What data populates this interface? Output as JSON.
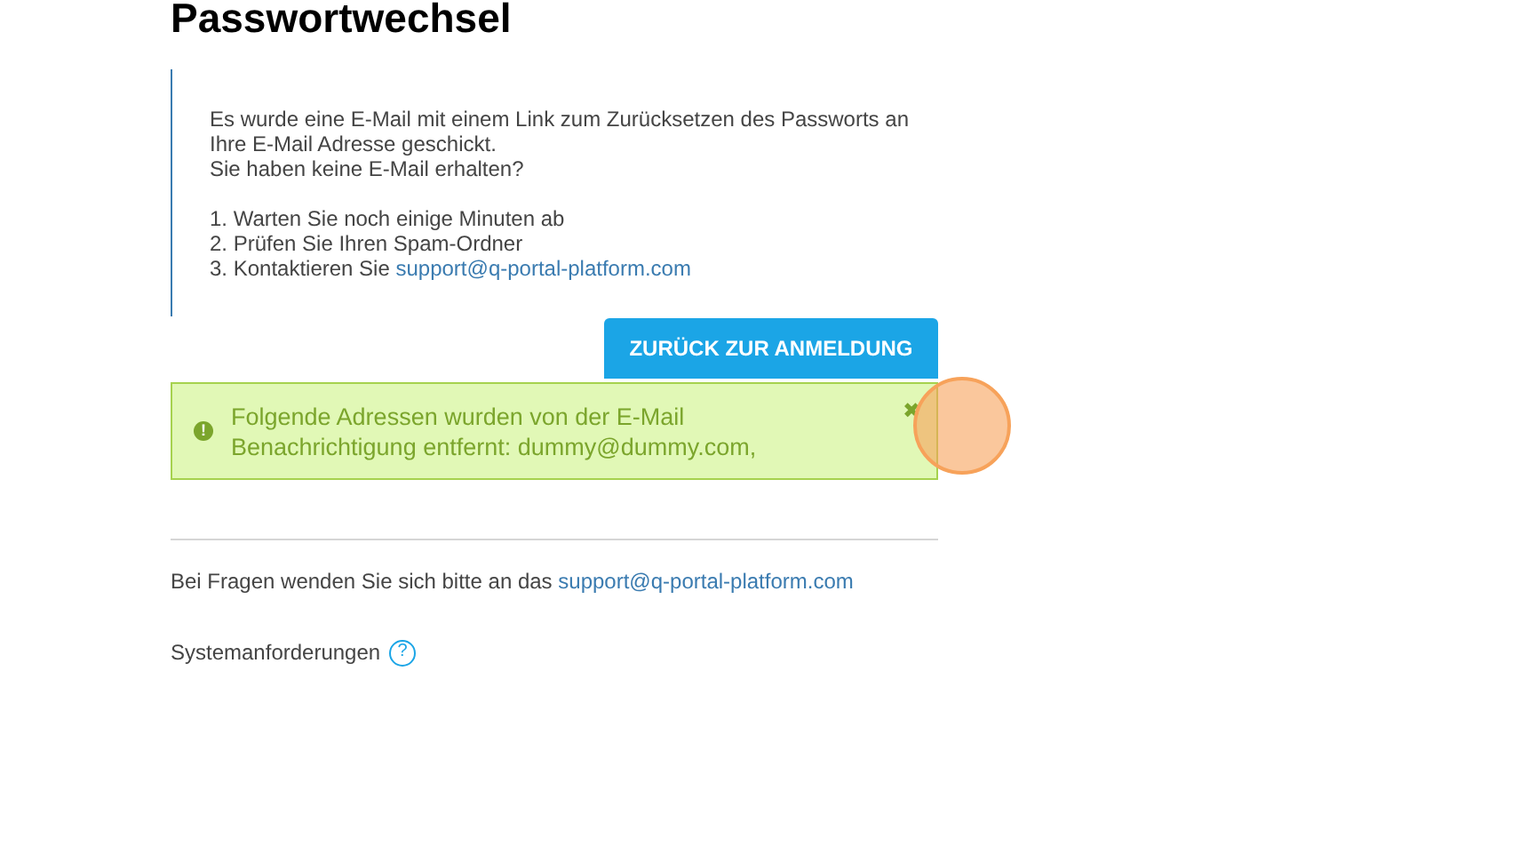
{
  "title": "Passwortwechsel",
  "info": {
    "message_lines": [
      "Es wurde eine E-Mail mit einem Link zum Zurücksetzen des Passworts an",
      "Ihre E-Mail Adresse geschickt."
    ],
    "question": "Sie haben keine E-Mail erhalten?",
    "steps": [
      {
        "text": "1. Warten Sie noch einige Minuten ab"
      },
      {
        "text": "2. Prüfen Sie Ihren Spam-Ordner"
      },
      {
        "text": "3. Kontaktieren Sie ",
        "link": "support@q-portal-platform.com"
      }
    ]
  },
  "back_button": "ZURÜCK ZUR ANMELDUNG",
  "alert": {
    "lines": [
      "Folgende Adressen wurden von der E-Mail",
      "Benachrichtigung entfernt: dummy@dummy.com,"
    ],
    "close": "✖",
    "icon": "!"
  },
  "footer": {
    "text": "Bei Fragen wenden Sie sich bitte an das ",
    "link": "support@q-portal-platform.com"
  },
  "requirements": {
    "label": "Systemanforderungen",
    "help": "?"
  }
}
